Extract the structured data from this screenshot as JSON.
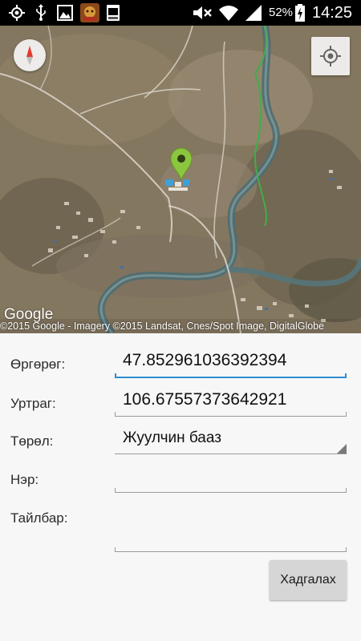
{
  "status_bar": {
    "battery_percent": "52%",
    "time": "14:25",
    "icons": [
      "gps-icon",
      "usb-icon",
      "gallery-icon",
      "app-notification-icon",
      "screenshot-icon",
      "mute-icon",
      "wifi-icon",
      "signal-icon",
      "battery-charging-icon"
    ]
  },
  "map": {
    "logo": "Google",
    "attribution": "©2015 Google - Imagery ©2015 Landsat, Cnes/Spot Image, DigitalGlobe"
  },
  "form": {
    "latitude_label": "Өргөрөг:",
    "latitude_value": "47.852961036392394",
    "longitude_label": "Уртраг:",
    "longitude_value": "106.67557373642921",
    "type_label": "Төрөл:",
    "type_value": "Жуулчин бааз",
    "name_label": "Нэр:",
    "name_value": "",
    "description_label": "Тайлбар:",
    "description_value": "",
    "save_label": "Хадгалах"
  },
  "colors": {
    "accent_blue": "#2d8bd0",
    "marker_green": "#8cc63f"
  }
}
